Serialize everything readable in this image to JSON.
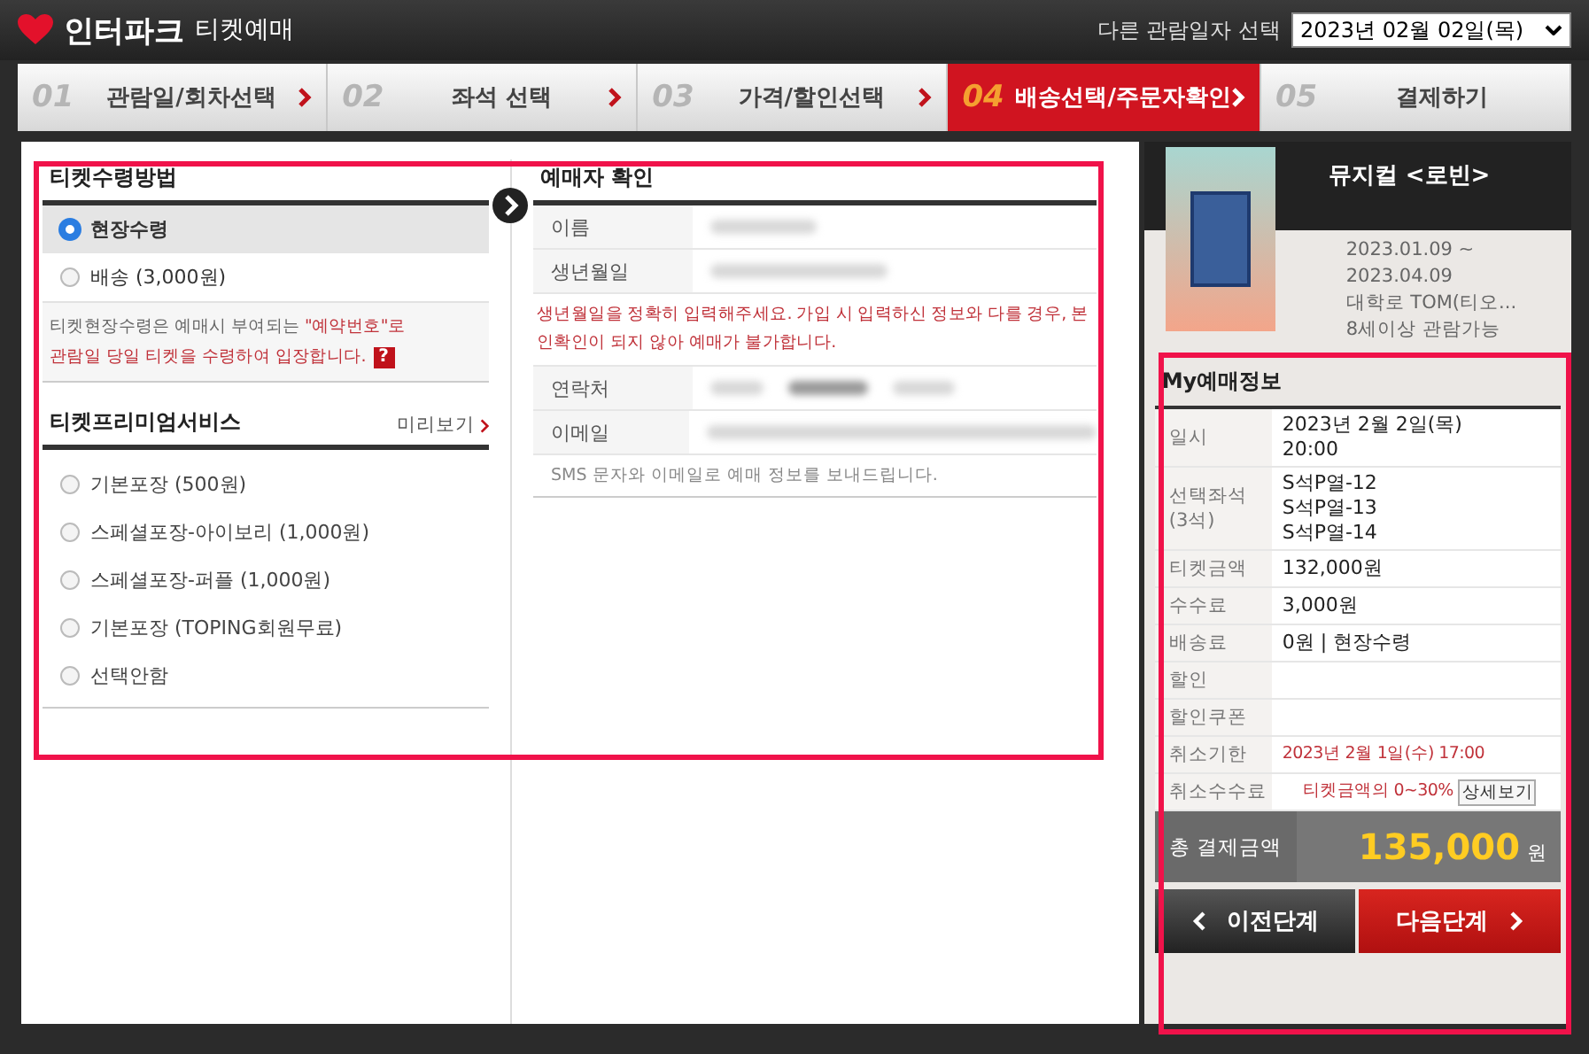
{
  "header": {
    "logo": "인터파크",
    "subtitle": "티켓예매",
    "date_label": "다른 관람일자 선택",
    "date_value": "2023년 02월 02일(목)"
  },
  "steps": [
    {
      "number": "01",
      "label": "관람일/회차선택",
      "selected": false
    },
    {
      "number": "02",
      "label": "좌석 선택",
      "selected": false
    },
    {
      "number": "03",
      "label": "가격/할인선택",
      "selected": false
    },
    {
      "number": "04",
      "label": "배송선택/주문자확인",
      "selected": true
    },
    {
      "number": "05",
      "label": "결제하기",
      "selected": false
    }
  ],
  "delivery": {
    "title": "티켓수령방법",
    "options": [
      {
        "label": "현장수령",
        "selected": true
      },
      {
        "label": "배송 (3,000원)",
        "selected": false
      }
    ],
    "notice": [
      [
        {
          "text": "티켓현장수령은 예매시 부여되는 ",
          "kind": "plain"
        },
        {
          "text": "\"예약번호\"로",
          "kind": "emphasis"
        }
      ],
      [
        {
          "text": "관람일 당일 티켓을 수령하여 입장합니다.",
          "kind": "emphasis"
        }
      ]
    ],
    "help": "?"
  },
  "premium": {
    "title": "티켓프리미엄서비스",
    "preview_link": "미리보기",
    "options": [
      {
        "label": "기본포장 (500원)",
        "selected": false
      },
      {
        "label": "스페셜포장-아이보리 (1,000원)",
        "selected": false
      },
      {
        "label": "스페셜포장-퍼플 (1,000원)",
        "selected": false
      },
      {
        "label": "기본포장 (TOPING회원무료)",
        "selected": false
      },
      {
        "label": "선택안함",
        "selected": false
      }
    ]
  },
  "buyer": {
    "title": "예매자 확인",
    "rows": [
      {
        "kind": "field",
        "label": "이름"
      },
      {
        "kind": "field",
        "label": "생년월일"
      },
      {
        "kind": "warning",
        "text": "생년월일을 정확히 입력해주세요. 가입 시 입력하신 정보와 다를 경우, 본인확인이 되지 않아 예매가 불가합니다."
      },
      {
        "kind": "phone",
        "label": "연락처"
      },
      {
        "kind": "field",
        "label": "이메일"
      },
      {
        "kind": "note",
        "text": "SMS 문자와 이메일로 예매 정보를 보내드립니다."
      }
    ]
  },
  "show": {
    "title": "뮤지컬 <로빈>",
    "details": [
      "2023.01.09 ~",
      "2023.04.09",
      "대학로 TOM(티오...",
      "8세이상 관람가능"
    ]
  },
  "summary": {
    "title": "My예매정보",
    "rows": [
      {
        "kind": "plain",
        "label": "일시",
        "values": [
          "2023년 2월 2일(목)",
          "20:00"
        ]
      },
      {
        "kind": "plain",
        "label": "선택좌석\n(3석)",
        "values": [
          "S석P열-12",
          "S석P열-13",
          "S석P열-14"
        ]
      },
      {
        "kind": "plain",
        "label": "티켓금액",
        "values": [
          "132,000원"
        ]
      },
      {
        "kind": "plain",
        "label": "수수료",
        "values": [
          "3,000원"
        ]
      },
      {
        "kind": "plain",
        "label": "배송료",
        "values": [
          "0원 | 현장수령"
        ]
      },
      {
        "kind": "plain",
        "label": "할인",
        "values": []
      },
      {
        "kind": "plain",
        "label": "할인쿠폰",
        "values": []
      },
      {
        "kind": "deadline",
        "label": "취소기한",
        "values": [
          "2023년 2월 1일(수) 17:00"
        ]
      },
      {
        "kind": "fee",
        "label": "취소수수료",
        "values": [
          "티켓금액의 0~30%"
        ],
        "button": "상세보기"
      }
    ],
    "total": {
      "label": "총 결제금액",
      "amount": "135,000",
      "unit": "원"
    }
  },
  "buttons": {
    "prev": "이전단계",
    "next": "다음단계"
  }
}
